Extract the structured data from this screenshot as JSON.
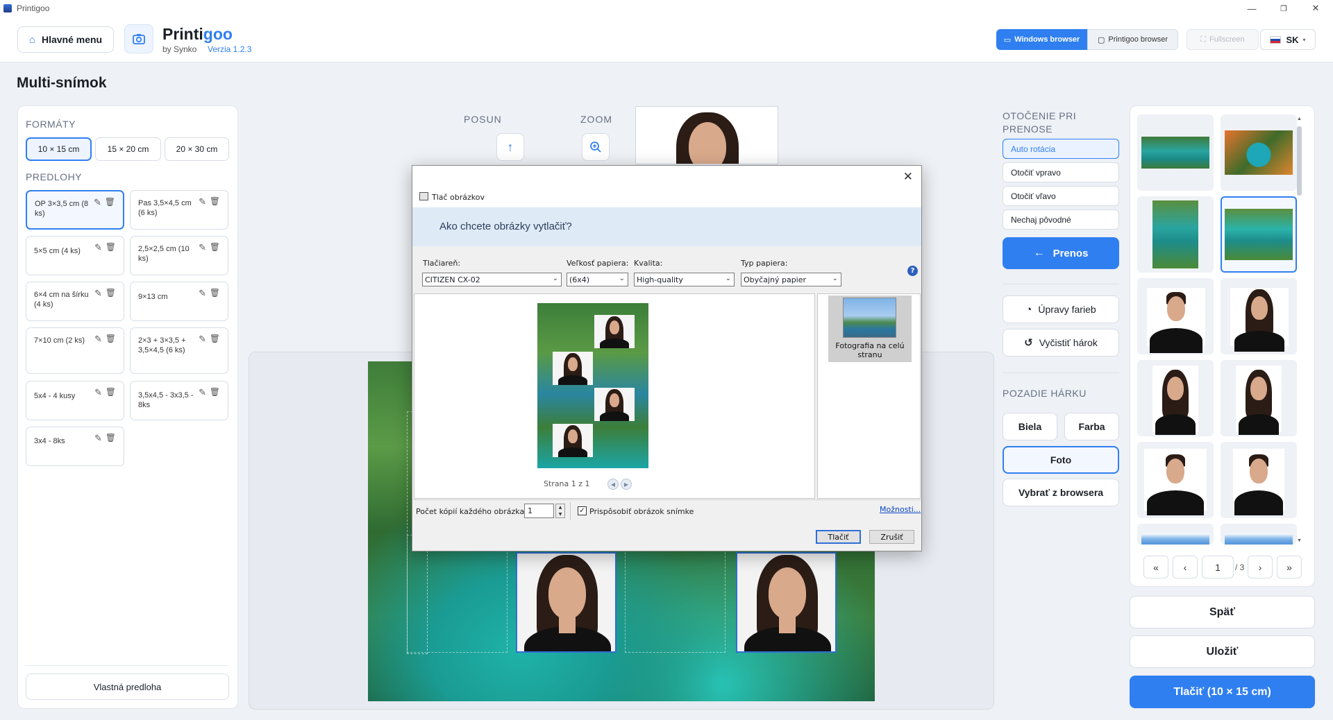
{
  "window": {
    "title": "Printigoo",
    "minimize": "—",
    "maximize": "❐",
    "close": "✕"
  },
  "header": {
    "main_menu": "Hlavné menu",
    "brand_name_a": "Printi",
    "brand_name_b": "goo",
    "brand_by": "by Synko",
    "brand_version": "Verzia 1.2.3",
    "windows_browser": "Windows browser",
    "printigoo_browser": "Printigoo browser",
    "fullscreen": "Fullscreen",
    "language": "SK"
  },
  "page": {
    "title": "Multi-snímok"
  },
  "left": {
    "formats_label": "FORMÁTY",
    "formats": [
      "10 × 15 cm",
      "15 × 20 cm",
      "20 × 30 cm"
    ],
    "templates_label": "PREDLOHY",
    "templates": [
      "OP 3×3,5 cm (8 ks)",
      "Pas 3,5×4,5 cm (6 ks)",
      "5×5 cm (4 ks)",
      "2,5×2,5 cm (10 ks)",
      "6×4 cm na šírku (4 ks)",
      "9×13 cm",
      "7×10 cm (2 ks)",
      "2×3 + 3×3,5 + 3,5×4,5 (6 ks)",
      "5x4 - 4 kusy",
      "3,5x4,5 - 3x3,5 - 8ks",
      "3x4 - 8ks"
    ],
    "custom_template": "Vlastná predloha"
  },
  "center": {
    "move_label": "POSUN",
    "zoom_label": "ZOOM"
  },
  "right": {
    "rotation_label_1": "OTOČENIE PRI",
    "rotation_label_2": "PRENOSE",
    "rotations": [
      "Auto rotácia",
      "Otočiť vpravo",
      "Otočiť vľavo",
      "Nechaj pôvodné"
    ],
    "transfer": "Prenos",
    "color_adjust": "Úpravy farieb",
    "clear_sheet": "Vyčistiť hárok",
    "background_label": "POZADIE HÁRKU",
    "bg_white": "Biela",
    "bg_color": "Farba",
    "bg_photo": "Foto",
    "choose_browser": "Vybrať z browsera"
  },
  "gallery": {
    "page_current": "1",
    "page_total": "/ 3",
    "first": "«",
    "prev": "‹",
    "next": "›",
    "last": "»"
  },
  "bottom": {
    "back": "Späť",
    "save": "Uložiť",
    "print": "Tlačiť (10 × 15 cm)"
  },
  "dialog": {
    "window_title": "Tlač obrázkov",
    "question": "Ako chcete obrázky vytlačiť?",
    "printer_label": "Tlačiareň:",
    "printer_value": "CITIZEN CX-02",
    "paper_size_label": "Veľkosť papiera:",
    "paper_size_value": "(6x4)",
    "quality_label": "Kvalita:",
    "quality_value": "High-quality",
    "paper_type_label": "Typ papiera:",
    "paper_type_value": "Obyčajný papier",
    "help": "?",
    "layout_option_line1": "Fotografia na celú",
    "layout_option_line2": "stranu",
    "page_info": "Strana 1 z 1",
    "copies_label": "Počet kópií každého obrázka:",
    "copies_value": "1",
    "fit_label": "Prispôsobiť obrázok snímke",
    "options_link": "Možnosti...",
    "print_button": "Tlačiť",
    "cancel_button": "Zrušiť"
  }
}
